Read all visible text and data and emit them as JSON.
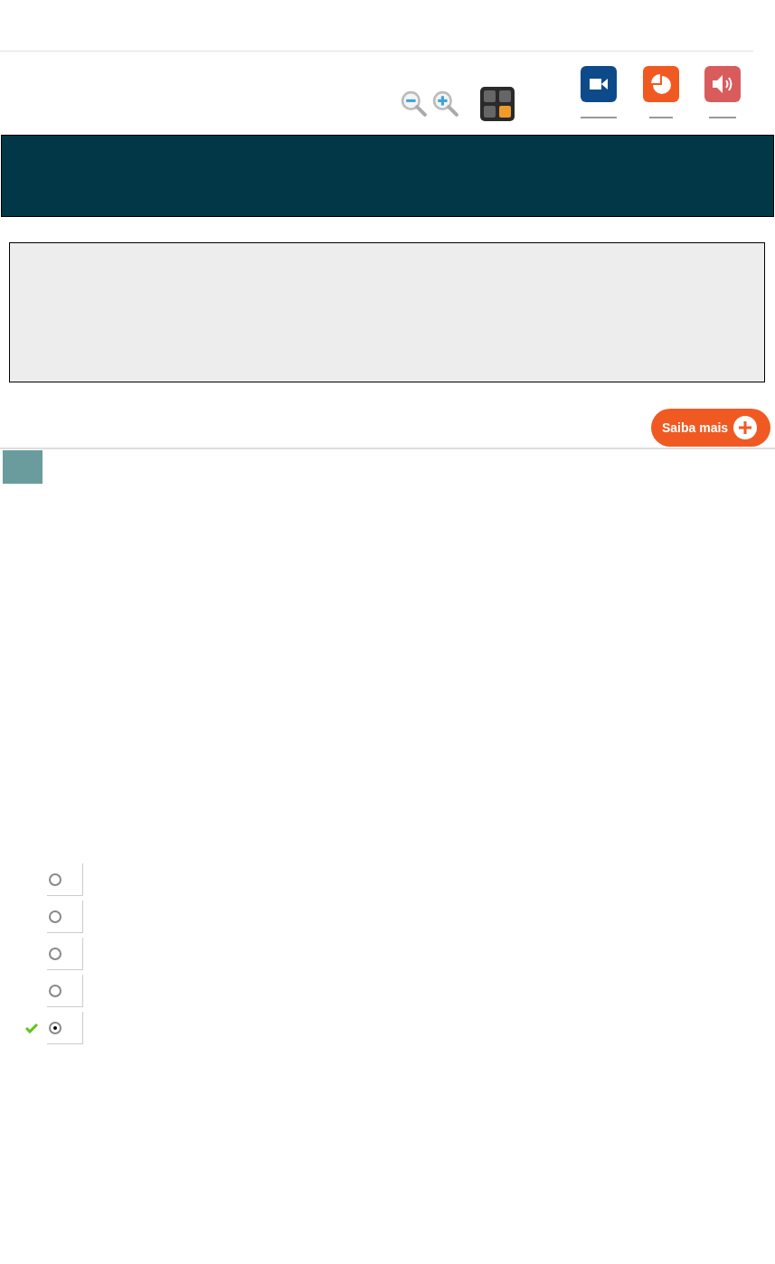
{
  "more_button": {
    "label": "Saiba mais"
  },
  "options": [
    {
      "selected": false,
      "correct": false
    },
    {
      "selected": false,
      "correct": false
    },
    {
      "selected": false,
      "correct": false
    },
    {
      "selected": false,
      "correct": false
    },
    {
      "selected": true,
      "correct": true
    }
  ]
}
